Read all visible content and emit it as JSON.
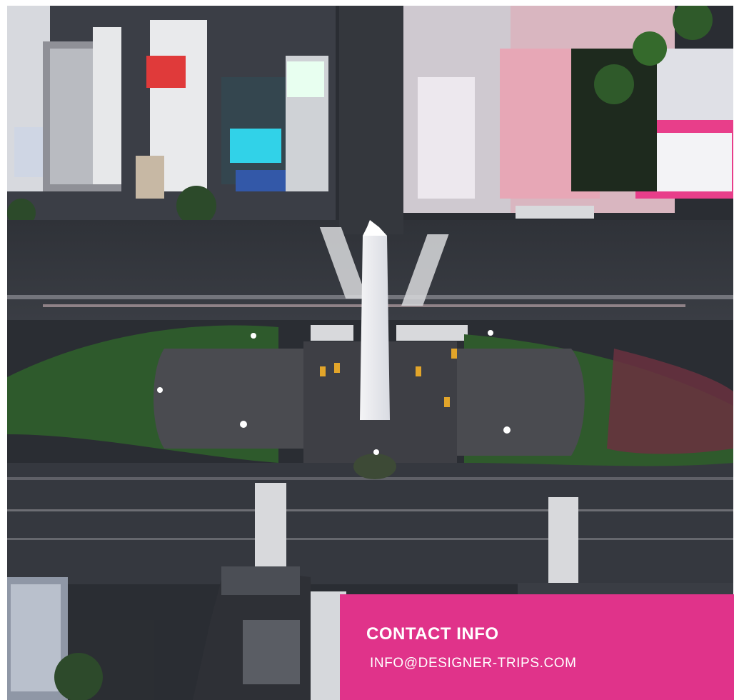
{
  "contact": {
    "title": "CONTACT INFO",
    "email": "INFO@DESIGNER-TRIPS.COM"
  },
  "colors": {
    "card_background": "#e0338a",
    "card_text": "#ffffff"
  }
}
